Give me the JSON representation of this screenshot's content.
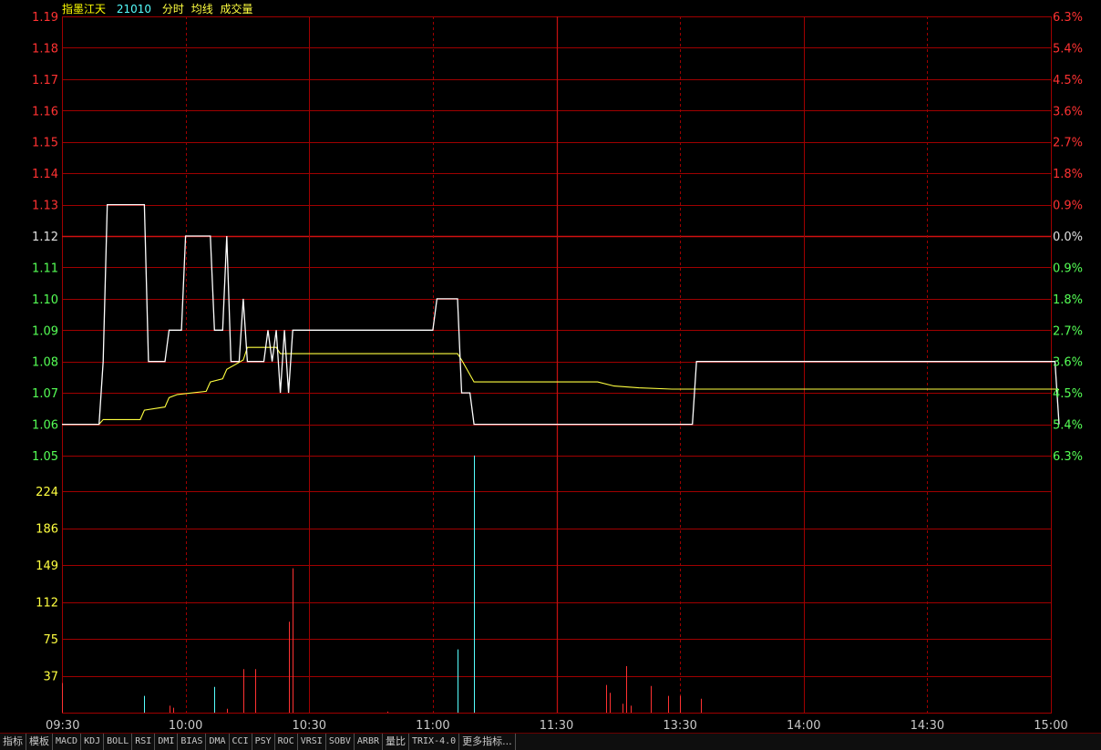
{
  "header": {
    "title": "指墨江天",
    "code": "21010",
    "tags": [
      "分时",
      "均线",
      "成交量"
    ]
  },
  "colors": {
    "up": "#ff3232",
    "down": "#55ff55",
    "neutral": "#e0e0e0",
    "grid": "#a00000",
    "price_line": "#ffffff",
    "avg_line": "#ffff40",
    "vol_up": "#ff3232",
    "vol_down": "#55ffff",
    "axis_text_time": "#c8c8c8",
    "vol_text": "#ffff40"
  },
  "chart_data": [
    {
      "type": "line",
      "reference_price": 1.12,
      "y_ticks": [
        "1.19",
        "1.18",
        "1.17",
        "1.16",
        "1.15",
        "1.14",
        "1.13",
        "1.12",
        "1.11",
        "1.10",
        "1.09",
        "1.08",
        "1.07",
        "1.06",
        "1.05"
      ],
      "pct_ticks": [
        "6.3%",
        "5.4%",
        "4.5%",
        "3.6%",
        "2.7%",
        "1.8%",
        "0.9%",
        "0.0%",
        "0.9%",
        "1.8%",
        "2.7%",
        "3.6%",
        "4.5%",
        "5.4%",
        "6.3%"
      ],
      "ylim": [
        1.05,
        1.19
      ],
      "x_ticks": [
        "09:30",
        "10:00",
        "10:30",
        "11:00",
        "11:30",
        "13:30",
        "14:00",
        "14:30",
        "15:00"
      ],
      "series": [
        {
          "role": "price",
          "points": [
            [
              0,
              1.06
            ],
            [
              9,
              1.06
            ],
            [
              10,
              1.08
            ],
            [
              11,
              1.13
            ],
            [
              20,
              1.13
            ],
            [
              21,
              1.08
            ],
            [
              25,
              1.08
            ],
            [
              26,
              1.09
            ],
            [
              29,
              1.09
            ],
            [
              30,
              1.12
            ],
            [
              36,
              1.12
            ],
            [
              37,
              1.09
            ],
            [
              39,
              1.09
            ],
            [
              40,
              1.12
            ],
            [
              41,
              1.08
            ],
            [
              43,
              1.08
            ],
            [
              44,
              1.1
            ],
            [
              45,
              1.08
            ],
            [
              49,
              1.08
            ],
            [
              50,
              1.09
            ],
            [
              51,
              1.08
            ],
            [
              52,
              1.09
            ],
            [
              53,
              1.07
            ],
            [
              54,
              1.09
            ],
            [
              55,
              1.07
            ],
            [
              56,
              1.09
            ],
            [
              90,
              1.09
            ],
            [
              91,
              1.1
            ],
            [
              96,
              1.1
            ],
            [
              97,
              1.07
            ],
            [
              99,
              1.07
            ],
            [
              100,
              1.06
            ],
            [
              153,
              1.06
            ],
            [
              154,
              1.08
            ],
            [
              241,
              1.08
            ],
            [
              242,
              1.06
            ]
          ]
        },
        {
          "role": "average",
          "points": [
            [
              0,
              1.06
            ],
            [
              9,
              1.06
            ],
            [
              10,
              1.0615
            ],
            [
              19,
              1.0615
            ],
            [
              20,
              1.0645
            ],
            [
              25,
              1.0655
            ],
            [
              26,
              1.0685
            ],
            [
              28,
              1.0695
            ],
            [
              35,
              1.0705
            ],
            [
              36,
              1.0735
            ],
            [
              39,
              1.0745
            ],
            [
              40,
              1.0775
            ],
            [
              44,
              1.0805
            ],
            [
              45,
              1.0845
            ],
            [
              52,
              1.0845
            ],
            [
              53,
              1.0825
            ],
            [
              96,
              1.0825
            ],
            [
              97,
              1.0805
            ],
            [
              100,
              1.0735
            ],
            [
              130,
              1.0735
            ],
            [
              134,
              1.0722
            ],
            [
              140,
              1.0716
            ],
            [
              148,
              1.0712
            ],
            [
              241,
              1.0712
            ],
            [
              242,
              1.071
            ]
          ]
        }
      ]
    },
    {
      "type": "bar",
      "role": "volume",
      "y_ticks": [
        "224",
        "186",
        "149",
        "112",
        "75",
        "37"
      ],
      "ylim": [
        0,
        260
      ],
      "bars": [
        [
          0,
          30,
          "up"
        ],
        [
          20,
          17,
          "down"
        ],
        [
          26,
          7,
          "up"
        ],
        [
          27,
          5,
          "up"
        ],
        [
          37,
          26,
          "down"
        ],
        [
          40,
          4,
          "up"
        ],
        [
          44,
          44,
          "up"
        ],
        [
          47,
          44,
          "up"
        ],
        [
          55,
          92,
          "up"
        ],
        [
          56,
          146,
          "up"
        ],
        [
          79,
          1,
          "up"
        ],
        [
          96,
          64,
          "down"
        ],
        [
          100,
          260,
          "down"
        ],
        [
          132,
          28,
          "up"
        ],
        [
          133,
          20,
          "up"
        ],
        [
          136,
          9,
          "up"
        ],
        [
          137,
          47,
          "up"
        ],
        [
          138,
          7,
          "up"
        ],
        [
          143,
          27,
          "up"
        ],
        [
          147,
          17,
          "up"
        ],
        [
          150,
          17,
          "up"
        ],
        [
          155,
          14,
          "up"
        ]
      ]
    }
  ],
  "tabs": [
    "指标",
    "模板",
    "MACD",
    "KDJ",
    "BOLL",
    "RSI",
    "DMI",
    "BIAS",
    "DMA",
    "CCI",
    "PSY",
    "ROC",
    "VRSI",
    "SOBV",
    "ARBR",
    "量比",
    "TRIX-4.0",
    "更多指标..."
  ]
}
